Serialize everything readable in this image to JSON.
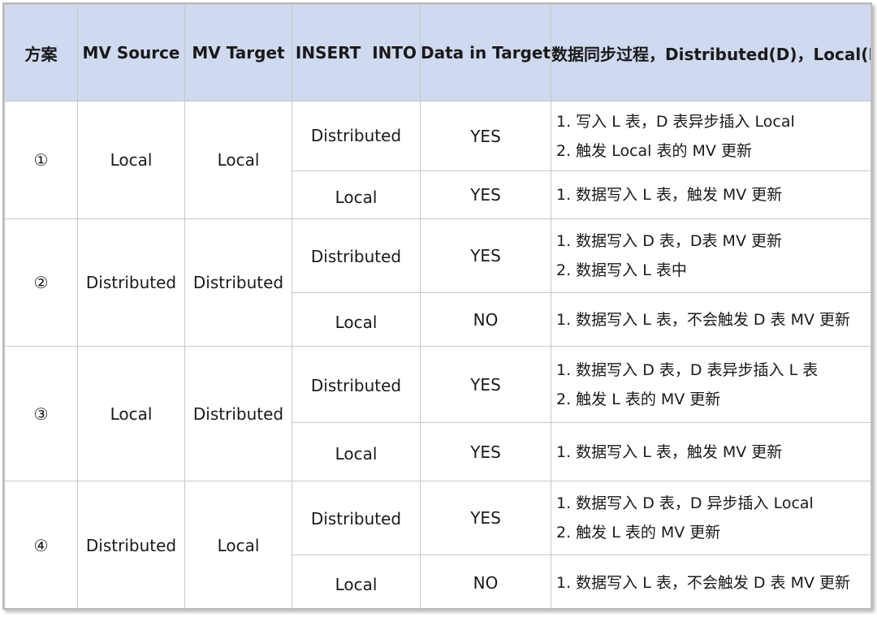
{
  "headers": {
    "scheme": "方案",
    "mv_source": "MV Source",
    "mv_target": "MV Target",
    "insert_into": "INSERT  INTO",
    "data_in_target": "Data in Target",
    "process": "数据同步过程，Distributed(D)，Local(L)"
  },
  "rows": [
    {
      "scheme": "①",
      "mv_source": "Local",
      "mv_target": "Local",
      "cases": [
        {
          "insert_into": "Distributed",
          "data_in_target": "YES",
          "process": [
            "1. 写入 L 表，D  表异步插入 Local",
            "2. 触发 Local 表的 MV 更新"
          ]
        },
        {
          "insert_into": "Local",
          "data_in_target": "YES",
          "process": [
            "1. 数据写入 L 表，触发 MV 更新"
          ]
        }
      ]
    },
    {
      "scheme": "②",
      "mv_source": "Distributed",
      "mv_target": "Distributed",
      "cases": [
        {
          "insert_into": "Distributed",
          "data_in_target": "YES",
          "process": [
            "1. 数据写入 D 表，D表 MV 更新",
            "2. 数据写入 L 表中"
          ]
        },
        {
          "insert_into": "Local",
          "data_in_target": "NO",
          "process": [
            "1. 数据写入 L 表，不会触发 D 表 MV 更新"
          ]
        }
      ]
    },
    {
      "scheme": "③",
      "mv_source": "Local",
      "mv_target": "Distributed",
      "cases": [
        {
          "insert_into": "Distributed",
          "data_in_target": "YES",
          "process": [
            "1. 数据写入 D 表，D 表异步插入 L 表",
            "2. 触发 L 表的 MV 更新"
          ]
        },
        {
          "insert_into": "Local",
          "data_in_target": "YES",
          "process": [
            "1. 数据写入 L 表，触发 MV 更新"
          ]
        }
      ]
    },
    {
      "scheme": "④",
      "mv_source": "Distributed",
      "mv_target": "Local",
      "cases": [
        {
          "insert_into": "Distributed",
          "data_in_target": "YES",
          "process": [
            "1. 数据写入 D 表，D 异步插入 Local",
            "2. 触发 L 表的 MV 更新"
          ]
        },
        {
          "insert_into": "Local",
          "data_in_target": "NO",
          "process": [
            "1. 数据写入 L 表，不会触发 D 表 MV 更新"
          ]
        }
      ]
    }
  ]
}
